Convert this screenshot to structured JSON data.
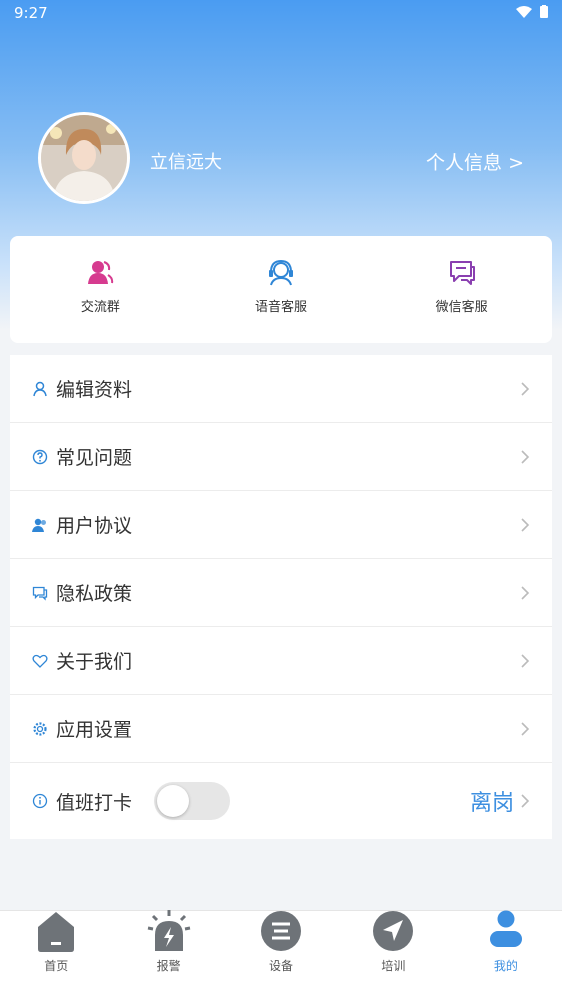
{
  "status_bar": {
    "time": "9:27"
  },
  "profile": {
    "username": "立信远大",
    "personal_info_label": "个人信息 >"
  },
  "quick_actions": [
    {
      "label": "交流群",
      "icon": "group-icon",
      "color": "#d63b8f"
    },
    {
      "label": "语音客服",
      "icon": "headset-icon",
      "color": "#2f86d6"
    },
    {
      "label": "微信客服",
      "icon": "chat-icon",
      "color": "#8a3fb0"
    }
  ],
  "menu": {
    "items": [
      {
        "label": "编辑资料",
        "icon": "user-icon"
      },
      {
        "label": "常见问题",
        "icon": "question-icon"
      },
      {
        "label": "用户协议",
        "icon": "users-icon"
      },
      {
        "label": "隐私政策",
        "icon": "message-icon"
      },
      {
        "label": "关于我们",
        "icon": "heart-icon"
      },
      {
        "label": "应用设置",
        "icon": "gear-icon"
      }
    ],
    "duty": {
      "label": "值班打卡",
      "icon": "info-icon",
      "status": "离岗",
      "toggle_on": false
    }
  },
  "colors": {
    "accent": "#3d8fe0",
    "icon_blue": "#2f86d6"
  },
  "bottom_nav": [
    {
      "label": "首页",
      "icon": "home-icon",
      "active": false
    },
    {
      "label": "报警",
      "icon": "alarm-icon",
      "active": false
    },
    {
      "label": "设备",
      "icon": "device-icon",
      "active": false
    },
    {
      "label": "培训",
      "icon": "navigation-icon",
      "active": false
    },
    {
      "label": "我的",
      "icon": "profile-icon",
      "active": true
    }
  ]
}
